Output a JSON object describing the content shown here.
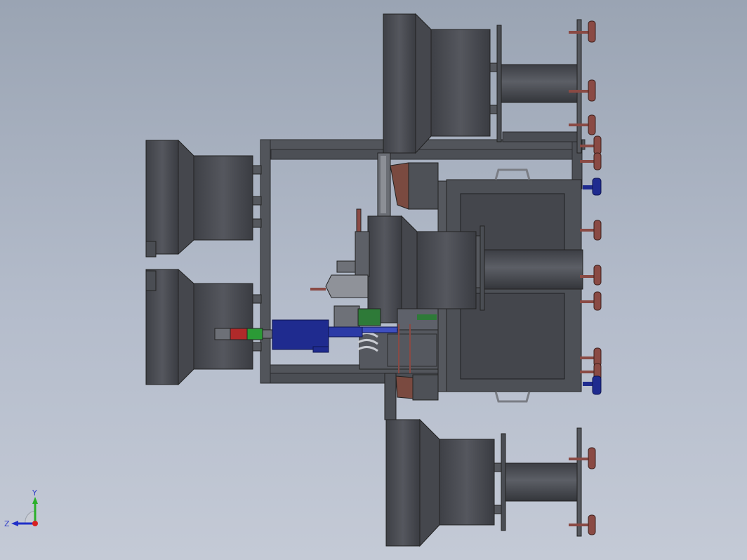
{
  "viewport": {
    "background_top": "#9aa4b3",
    "background_bottom": "#c4cad6"
  },
  "model": {
    "body_color": "#4a4c52",
    "frame_color": "#5a5d63",
    "valve_color": "#8a4a44",
    "motor_color": "#1f2b8f"
  },
  "triad": {
    "y_label": "Y",
    "z_label": "Z",
    "y_axis_color": "#2ab02a",
    "z_axis_color": "#2030c8",
    "origin_color": "#d82020"
  }
}
